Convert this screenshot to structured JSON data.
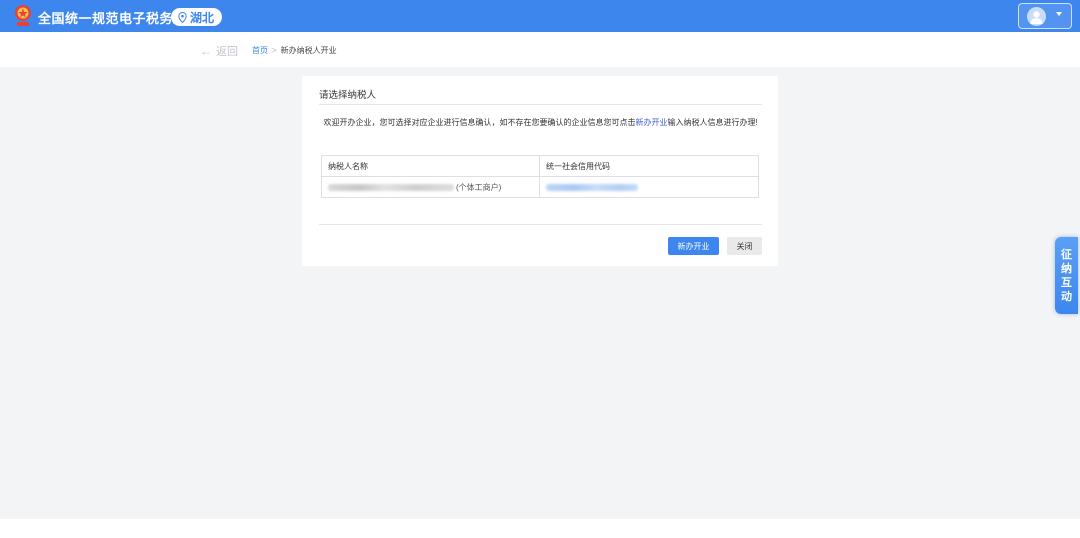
{
  "header": {
    "site_title": "全国统一规范电子税务局",
    "region": "湖北",
    "logo_icon": "tax-emblem-icon",
    "region_icon": "location-pin-icon",
    "user_icon": "user-avatar-icon",
    "brand_color": "#3d86ee"
  },
  "breadcrumb": {
    "back_label": "返回",
    "home_label": "首页",
    "separator": ">",
    "current_label": "新办纳税人开业"
  },
  "card": {
    "title": "请选择纳税人",
    "intro_before": "欢迎开办企业，您可选择对应企业进行信息确认，如不存在您要确认的企业信息您可点击",
    "intro_link": "新办开业",
    "intro_after": "输入纳税人信息进行办理!",
    "table": {
      "columns": [
        "纳税人名称",
        "统一社会信用代码"
      ],
      "rows": [
        {
          "name_suffix": "(个体工商户)"
        }
      ]
    },
    "new_button_label": "新办开业",
    "close_button_label": "关闭"
  },
  "side_tab": {
    "chars": [
      "征",
      "纳",
      "互",
      "动"
    ]
  }
}
